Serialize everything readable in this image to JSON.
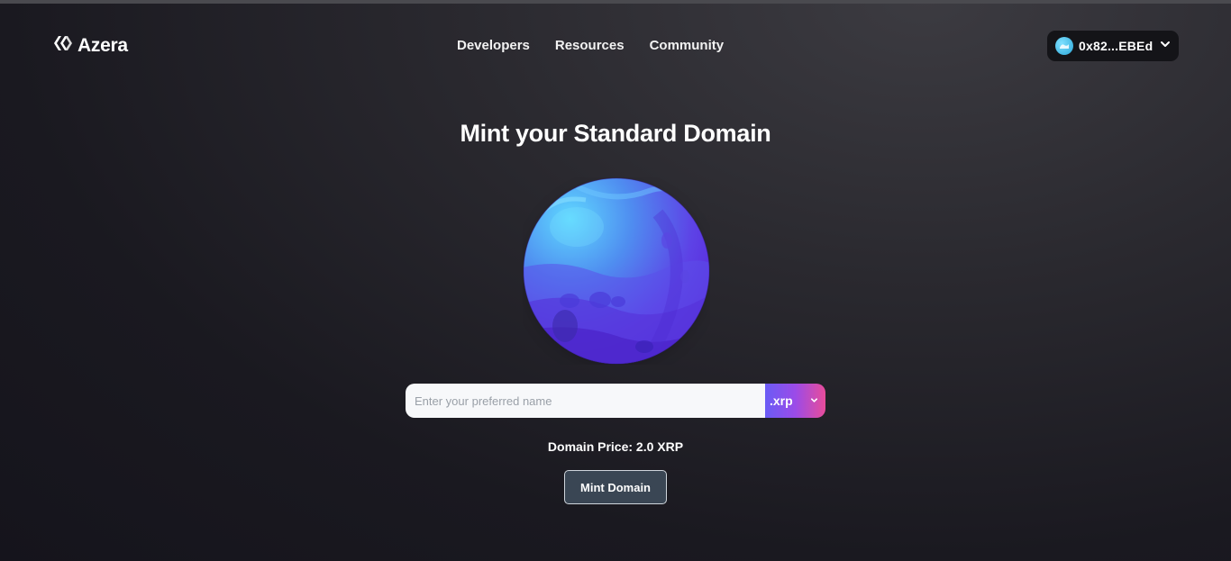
{
  "brand": {
    "name": "Azera"
  },
  "nav": {
    "items": [
      {
        "label": "Developers"
      },
      {
        "label": "Resources"
      },
      {
        "label": "Community"
      }
    ]
  },
  "wallet": {
    "address": "0x82...EBEd"
  },
  "main": {
    "title": "Mint your Standard Domain",
    "name_input": {
      "placeholder": "Enter your preferred name",
      "value": ""
    },
    "tld_select": {
      "selected": ".xrp"
    },
    "price_text": "Domain Price: 2.0 XRP",
    "mint_button_label": "Mint Domain"
  },
  "colors": {
    "background": "#1c1b22",
    "tld_gradient_start": "#6a5cf5",
    "tld_gradient_end": "#e84c9a",
    "mint_button_bg": "#3a4654",
    "planet_light": "#5fd3ff",
    "planet_dark": "#5a1fd6"
  },
  "icons": {
    "logo": "azera-logo-icon",
    "wallet_avatar": "wallet-avatar-icon",
    "wallet_chevron": "chevron-down-icon",
    "tld_chevron": "chevron-down-icon",
    "planet": "planet-illustration"
  }
}
